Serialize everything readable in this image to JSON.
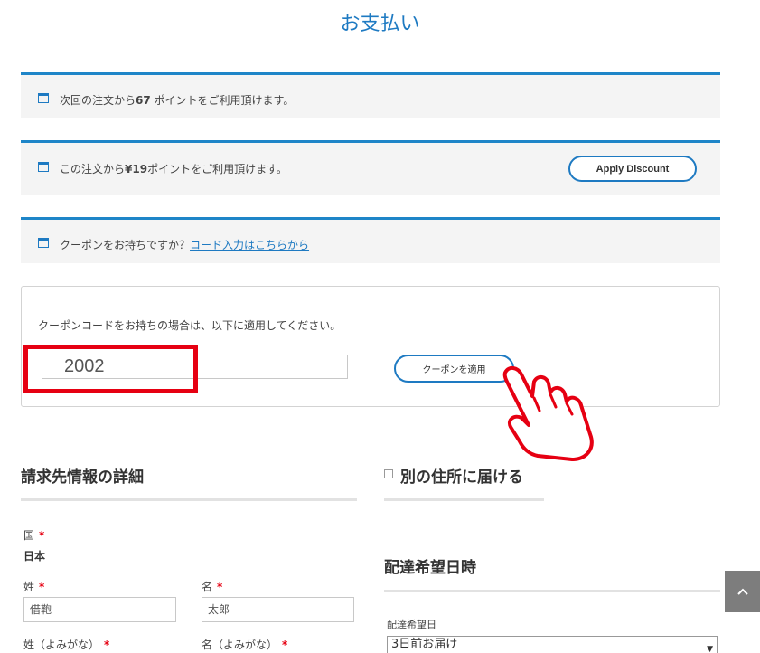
{
  "page": {
    "title": "お支払い"
  },
  "notices": {
    "points_next": {
      "text_pre": "次回の注文から",
      "points": "67",
      "text_post": " ポイントをご利用頂けます。"
    },
    "points_now": {
      "text_pre": "この注文から",
      "amount": "¥19",
      "text_post": "ポイントをご利用頂けます。",
      "button": "Apply Discount"
    },
    "coupon": {
      "text": "クーポンをお持ちですか？",
      "link": "コード入力はこちらから"
    }
  },
  "coupon_form": {
    "description": "クーポンコードをお持ちの場合は、以下に適用してください。",
    "code_value": "2002",
    "apply_button": "クーポンを適用"
  },
  "billing": {
    "heading": "請求先情報の詳細",
    "country_label": "国",
    "country_value": "日本",
    "last_name_label": "姓",
    "last_name_value": "借鞄",
    "first_name_label": "名",
    "first_name_value": "太郎",
    "last_name_kana_label": "姓（よみがな）",
    "first_name_kana_label": "名（よみがな）",
    "required_mark": "*"
  },
  "shipping": {
    "heading": "別の住所に届ける"
  },
  "delivery": {
    "heading": "配達希望日時",
    "date_label": "配達希望日",
    "date_value": "3日前お届け"
  },
  "colors": {
    "accent": "#1e7ac2",
    "highlight": "#e60012"
  },
  "icons": [
    "window-icon",
    "chevron-up-icon",
    "pointing-hand-icon",
    "dropdown-arrow-icon"
  ]
}
